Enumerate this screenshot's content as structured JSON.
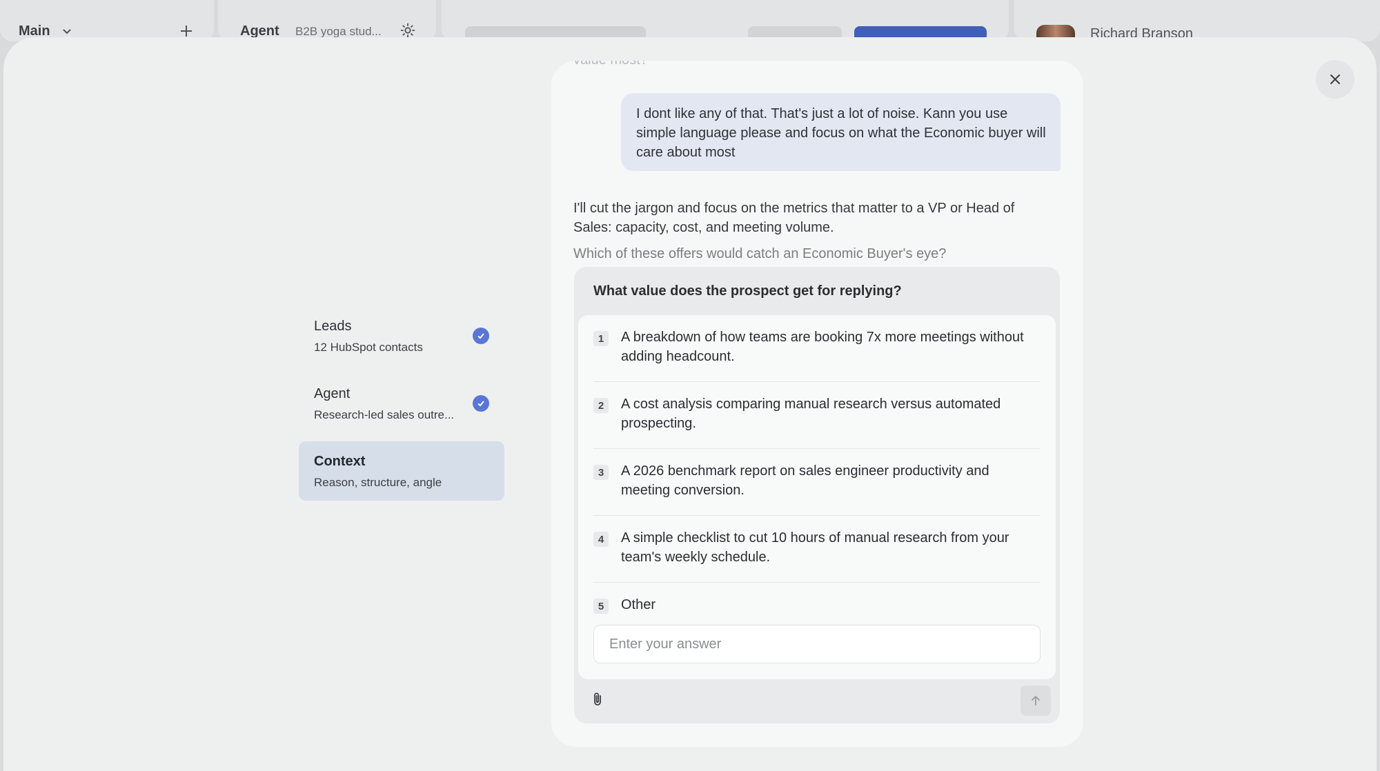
{
  "background": {
    "main_label": "Main",
    "agent_label": "Agent",
    "agent_desc": "B2B yoga stud...",
    "user_name": "Richard Branson"
  },
  "steps": [
    {
      "title": "Leads",
      "subtitle": "12 HubSpot contacts",
      "done": true
    },
    {
      "title": "Agent",
      "subtitle": "Research-led sales outre...",
      "done": true
    },
    {
      "title": "Context",
      "subtitle": "Reason, structure, angle",
      "done": false,
      "active": true
    }
  ],
  "chat": {
    "faded_top": "value most?",
    "user_message": "I dont like any of that. That's just a lot of noise. Kann you use simple language please and focus on what the Economic buyer will care about most",
    "assistant_message": "I'll cut the jargon and focus on the metrics that matter to a VP or Head of Sales: capacity, cost, and meeting volume.",
    "assistant_faded": "Which of these offers would catch an Economic Buyer's eye?"
  },
  "question": {
    "title": "What value does the prospect get for replying?",
    "options": [
      {
        "num": "1",
        "text": "A breakdown of how teams are booking 7x more meetings without adding headcount."
      },
      {
        "num": "2",
        "text": "A cost analysis comparing manual research versus automated prospecting."
      },
      {
        "num": "3",
        "text": "A 2026 benchmark report on sales engineer productivity and meeting conversion."
      },
      {
        "num": "4",
        "text": "A simple checklist to cut 10 hours of manual research from your team's weekly schedule."
      },
      {
        "num": "5",
        "text": "Other"
      }
    ],
    "input_placeholder": "Enter your answer",
    "input_value": ""
  },
  "colors": {
    "accent": "#5a76d6",
    "active_step": "#d6dee9",
    "user_bubble": "#e3e7f1"
  },
  "icons": {
    "close": "close-icon",
    "attach": "paperclip-icon",
    "send": "arrow-up-icon",
    "check": "check-circle-icon",
    "add": "plus-icon",
    "settings": "gear-icon"
  }
}
